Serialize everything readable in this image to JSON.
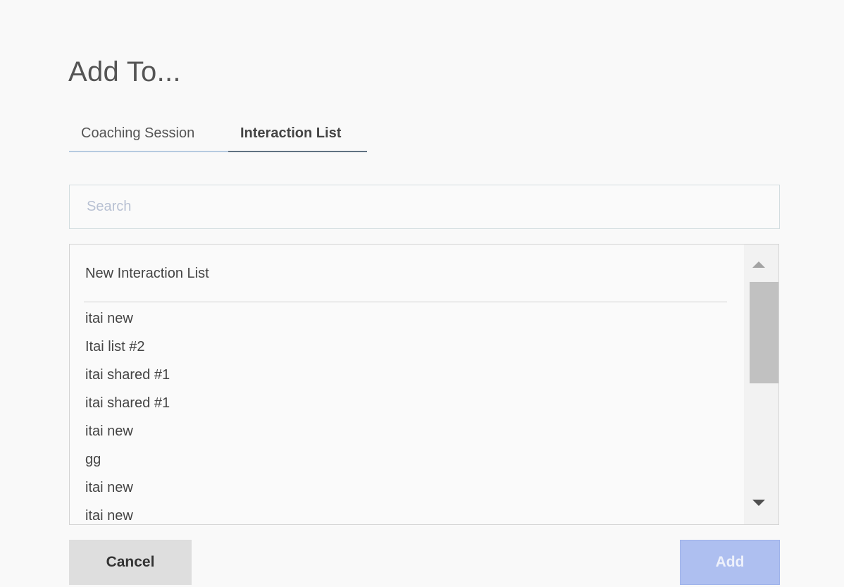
{
  "dialog": {
    "title": "Add To..."
  },
  "tabs": [
    {
      "label": "Coaching Session",
      "active": false
    },
    {
      "label": "Interaction List",
      "active": true
    }
  ],
  "search": {
    "placeholder": "Search",
    "value": ""
  },
  "list": {
    "new_item_label": "New Interaction List",
    "items": [
      "itai new",
      "Itai list #2",
      "itai shared #1",
      "itai shared #1",
      "itai new",
      "gg",
      "itai new",
      "itai new"
    ]
  },
  "buttons": {
    "cancel_label": "Cancel",
    "add_label": "Add",
    "add_enabled": false
  },
  "colors": {
    "active_tab_underline": "#607282",
    "inactive_tab_underline": "#b6cbe0",
    "add_button_disabled": "#aebff0",
    "cancel_button": "#dedede"
  },
  "icons": {
    "scroll_up": "triangle-up",
    "scroll_down": "triangle-down"
  }
}
